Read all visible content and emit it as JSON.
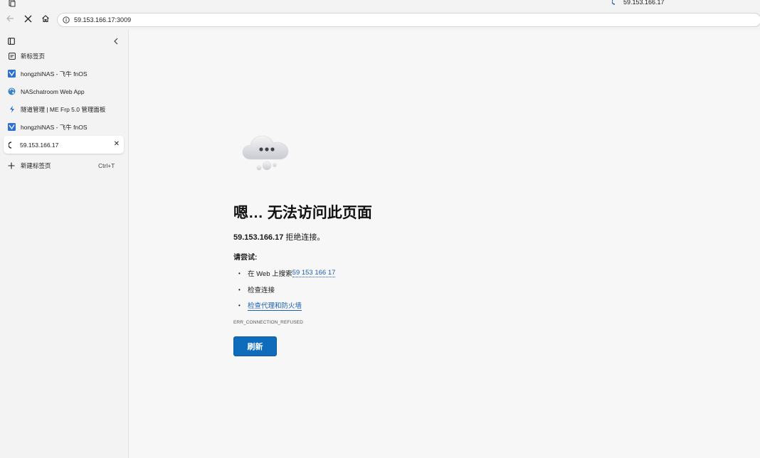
{
  "window": {
    "tab_title": "59.153.166.17"
  },
  "toolbar": {
    "url": "59.153.166.17:3009"
  },
  "sidebar": {
    "tabs": [
      {
        "label": "新标签页",
        "icon": "new-tab-page-icon"
      },
      {
        "label": "hongzhiNAS - 飞牛 fnOS",
        "icon": "fnos-icon"
      },
      {
        "label": "NASchatroom Web App",
        "icon": "chat-app-icon"
      },
      {
        "label": "隧道管理 | ME Frp 5.0 管理面板",
        "icon": "bolt-icon"
      },
      {
        "label": "hongzhiNAS - 飞牛 fnOS",
        "icon": "fnos-icon"
      }
    ],
    "active_tab": {
      "label": "59.153.166.17",
      "icon": "loading-spinner-icon"
    },
    "new_tab": {
      "label": "新建标签页",
      "shortcut": "Ctrl+T"
    }
  },
  "error_page": {
    "title": "嗯… 无法访问此页面",
    "host": "59.153.166.17",
    "reason": " 拒绝连接。",
    "try_label": "请尝试:",
    "suggestion_search_prefix": "在 Web 上搜索 ",
    "suggestion_search_link": "59 153 166 17",
    "suggestion_check_connection": "检查连接",
    "suggestion_check_proxy": "检查代理和防火墙",
    "error_code": "ERR_CONNECTION_REFUSED",
    "refresh_label": "刷新"
  },
  "colors": {
    "accent": "#0f6cbd",
    "link": "#1a5fb4"
  }
}
